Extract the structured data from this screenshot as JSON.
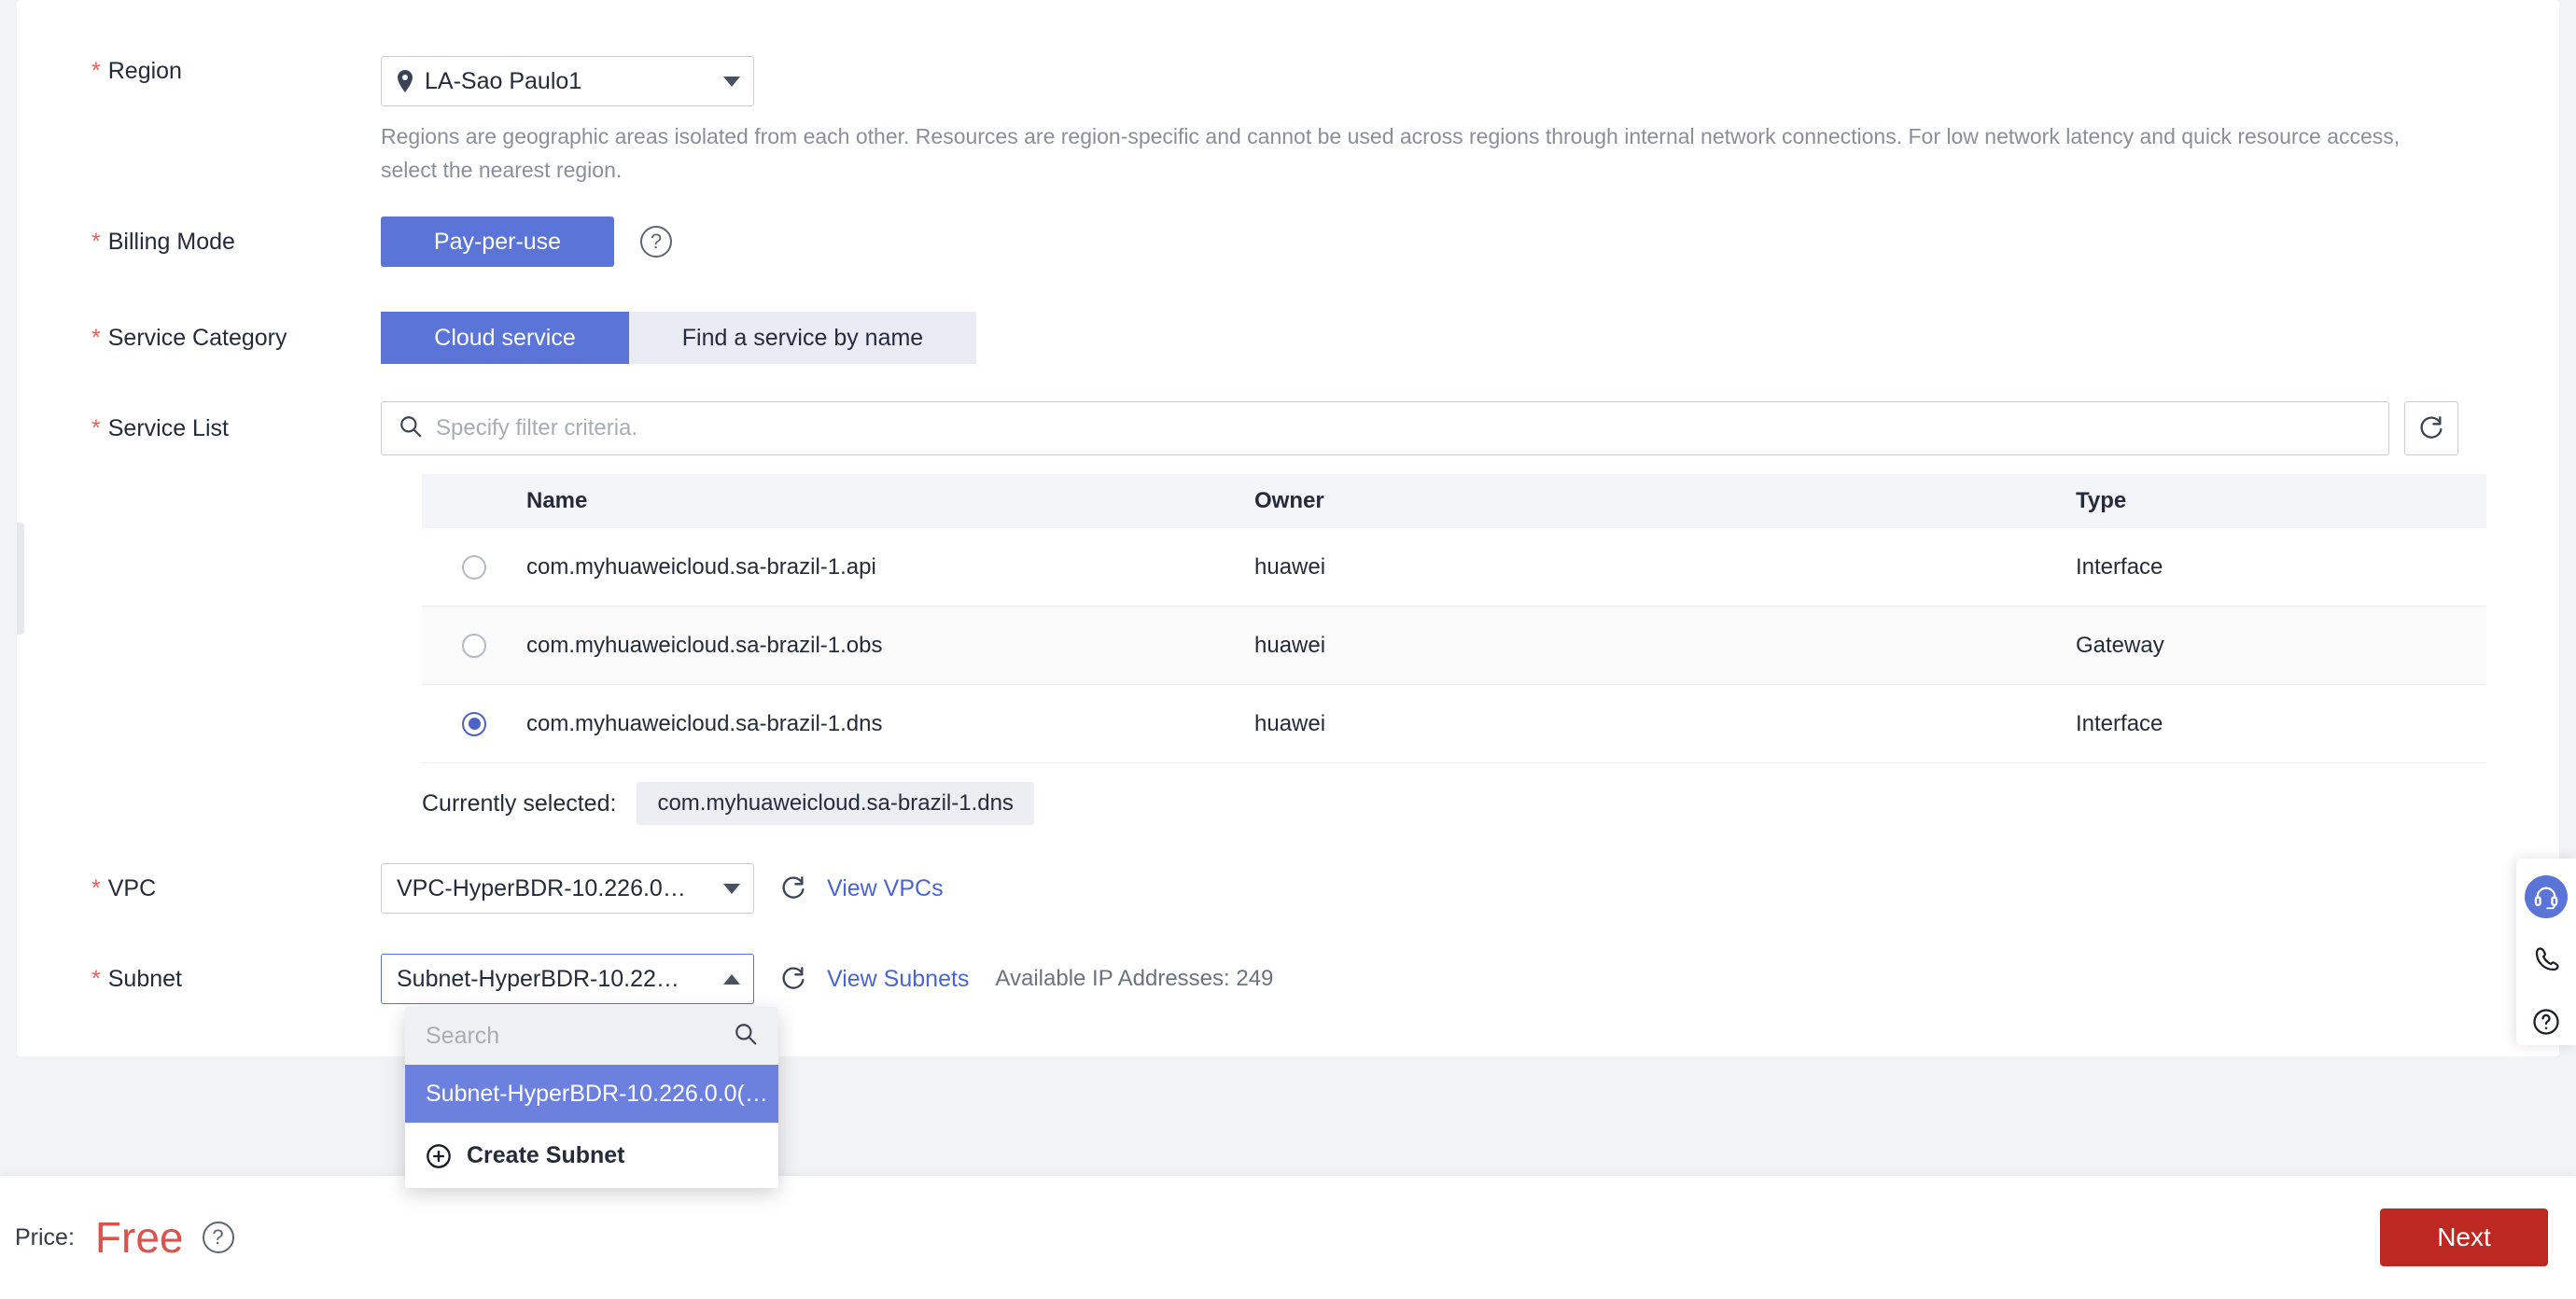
{
  "form": {
    "region": {
      "label": "Region",
      "required": true,
      "value": "LA-Sao Paulo1",
      "helper": "Regions are geographic areas isolated from each other. Resources are region-specific and cannot be used across regions through internal network connections. For low network latency and quick resource access, select the nearest region."
    },
    "billing_mode": {
      "label": "Billing Mode",
      "required": true,
      "option": "Pay-per-use"
    },
    "service_category": {
      "label": "Service Category",
      "required": true,
      "options": [
        "Cloud service",
        "Find a service by name"
      ],
      "selected": "Cloud service"
    },
    "service_list": {
      "label": "Service List",
      "required": true,
      "filter_placeholder": "Specify filter criteria.",
      "filter_value": "",
      "columns": [
        "Name",
        "Owner",
        "Type"
      ],
      "rows": [
        {
          "name": "com.myhuaweicloud.sa-brazil-1.api",
          "owner": "huawei",
          "type": "Interface",
          "selected": false
        },
        {
          "name": "com.myhuaweicloud.sa-brazil-1.obs",
          "owner": "huawei",
          "type": "Gateway",
          "selected": false
        },
        {
          "name": "com.myhuaweicloud.sa-brazil-1.dns",
          "owner": "huawei",
          "type": "Interface",
          "selected": true
        }
      ],
      "currently_selected_label": "Currently selected:",
      "currently_selected_value": "com.myhuaweicloud.sa-brazil-1.dns"
    },
    "vpc": {
      "label": "VPC",
      "required": true,
      "value": "VPC-HyperBDR-10.226.0…",
      "link": "View VPCs"
    },
    "subnet": {
      "label": "Subnet",
      "required": true,
      "value": "Subnet-HyperBDR-10.22…",
      "link": "View Subnets",
      "available_ips": "Available IP Addresses: 249",
      "dropdown": {
        "search_placeholder": "Search",
        "search_value": "",
        "options": [
          {
            "label": "Subnet-HyperBDR-10.226.0.0(…",
            "selected": true
          }
        ],
        "create_label": "Create Subnet"
      }
    }
  },
  "footer": {
    "price_label": "Price:",
    "price_value": "Free",
    "next_label": "Next"
  },
  "colors": {
    "accent": "#5a74d8",
    "required_star": "#e8615a",
    "price": "#d9534f",
    "next_button": "#bd2822",
    "link": "#4a64d4"
  },
  "icons": {
    "location": "location-pin-icon",
    "search": "search-icon",
    "refresh": "refresh-icon",
    "help": "help-circle-icon",
    "plus": "plus-circle-icon",
    "headset": "headset-icon",
    "phone": "phone-icon"
  }
}
